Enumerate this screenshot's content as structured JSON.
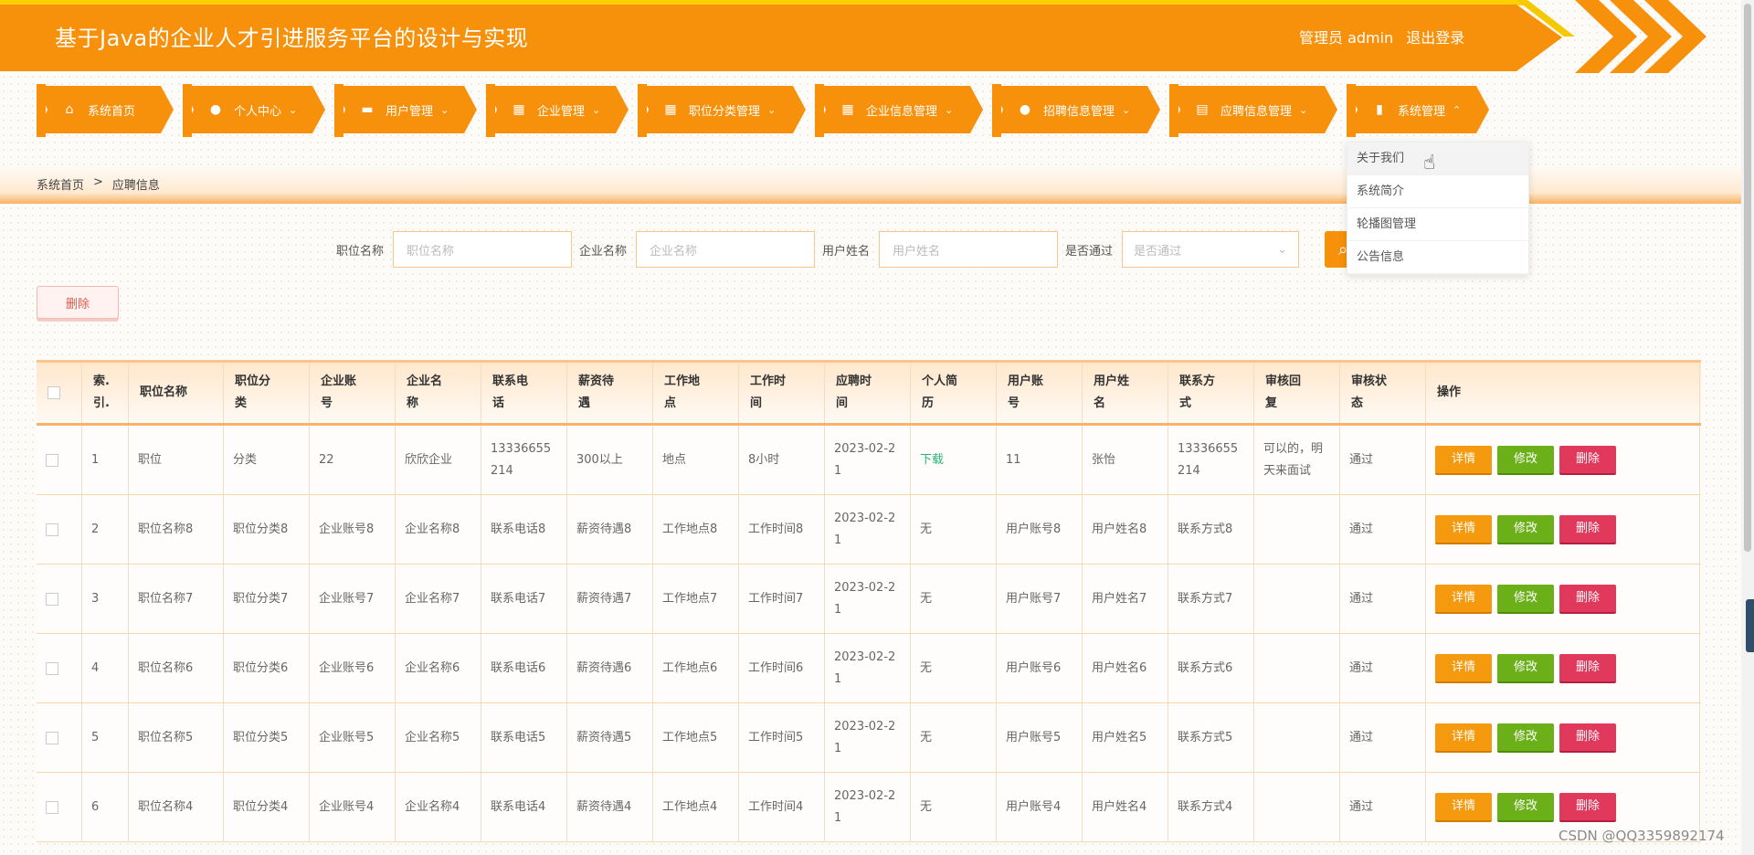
{
  "header": {
    "title": "基于Java的企业人才引进服务平台的设计与实现",
    "user_label": "管理员 admin",
    "logout": "退出登录"
  },
  "nav": [
    {
      "label": "系统首页",
      "icon": "home-icon",
      "glyph": "⌂"
    },
    {
      "label": "个人中心",
      "icon": "user-icon",
      "glyph": "●"
    },
    {
      "label": "用户管理",
      "icon": "ticket-icon",
      "glyph": "▬"
    },
    {
      "label": "企业管理",
      "icon": "grid-icon",
      "glyph": "▦"
    },
    {
      "label": "职位分类管理",
      "icon": "grid-icon",
      "glyph": "▦"
    },
    {
      "label": "企业信息管理",
      "icon": "grid-icon",
      "glyph": "▦"
    },
    {
      "label": "招聘信息管理",
      "icon": "bulb-icon",
      "glyph": "●"
    },
    {
      "label": "应聘信息管理",
      "icon": "clipboard-icon",
      "glyph": "▤"
    },
    {
      "label": "系统管理",
      "icon": "bar-chart-icon",
      "glyph": "▮"
    }
  ],
  "dropdown": [
    "关于我们",
    "系统简介",
    "轮播图管理",
    "公告信息"
  ],
  "breadcrumb": {
    "home": "系统首页",
    "sep": ">",
    "current": "应聘信息"
  },
  "search": {
    "fields": [
      {
        "label": "职位名称",
        "placeholder": "职位名称"
      },
      {
        "label": "企业名称",
        "placeholder": "企业名称"
      },
      {
        "label": "用户姓名",
        "placeholder": "用户姓名"
      }
    ],
    "select": {
      "label": "是否通过",
      "placeholder": "是否通过"
    }
  },
  "delete_button": "删除",
  "table": {
    "headers": [
      "索.\n引.",
      "职位名称",
      "职位分\n类",
      "企业账\n号",
      "企业名\n称",
      "联系电\n话",
      "薪资待\n遇",
      "工作地\n点",
      "工作时\n间",
      "应聘时\n间",
      "个人简\n历",
      "用户账\n号",
      "用户姓\n名",
      "联系方\n式",
      "审核回\n复",
      "审核状\n态",
      "操作"
    ],
    "rows": [
      [
        "1",
        "职位",
        "分类",
        "22",
        "欣欣企业",
        "13336655\n214",
        "300以上",
        "地点",
        "8小时",
        "2023-02-2\n1",
        "下载",
        "11",
        "张怡",
        "13336655\n214",
        "可以的，明\n天来面试",
        "通过"
      ],
      [
        "2",
        "职位名称8",
        "职位分类8",
        "企业账号8",
        "企业名称8",
        "联系电话8",
        "薪资待遇8",
        "工作地点8",
        "工作时间8",
        "2023-02-2\n1",
        "无",
        "用户账号8",
        "用户姓名8",
        "联系方式8",
        "",
        "通过"
      ],
      [
        "3",
        "职位名称7",
        "职位分类7",
        "企业账号7",
        "企业名称7",
        "联系电话7",
        "薪资待遇7",
        "工作地点7",
        "工作时间7",
        "2023-02-2\n1",
        "无",
        "用户账号7",
        "用户姓名7",
        "联系方式7",
        "",
        "通过"
      ],
      [
        "4",
        "职位名称6",
        "职位分类6",
        "企业账号6",
        "企业名称6",
        "联系电话6",
        "薪资待遇6",
        "工作地点6",
        "工作时间6",
        "2023-02-2\n1",
        "无",
        "用户账号6",
        "用户姓名6",
        "联系方式6",
        "",
        "通过"
      ],
      [
        "5",
        "职位名称5",
        "职位分类5",
        "企业账号5",
        "企业名称5",
        "联系电话5",
        "薪资待遇5",
        "工作地点5",
        "工作时间5",
        "2023-02-2\n1",
        "无",
        "用户账号5",
        "用户姓名5",
        "联系方式5",
        "",
        "通过"
      ],
      [
        "6",
        "职位名称4",
        "职位分类4",
        "企业账号4",
        "企业名称4",
        "联系电话4",
        "薪资待遇4",
        "工作地点4",
        "工作时间4",
        "2023-02-2\n1",
        "无",
        "用户账号4",
        "用户姓名4",
        "联系方式4",
        "",
        "通过"
      ]
    ],
    "actions": {
      "detail": "详情",
      "edit": "修改",
      "delete": "删除"
    }
  },
  "watermark": "CSDN @QQ3359892174",
  "colors": {
    "primary": "#f7900a",
    "accent": "#ffd000",
    "detail": "#f59a0e",
    "edit": "#6bb019",
    "delete": "#e0395b"
  }
}
